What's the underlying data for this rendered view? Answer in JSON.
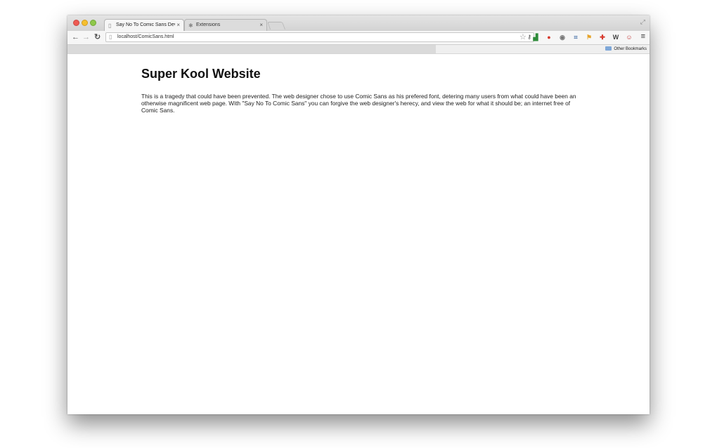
{
  "browser": {
    "tabs": [
      {
        "title": "Say No To Comic Sans Dev",
        "active": true
      },
      {
        "title": "Extensions",
        "active": false
      }
    ],
    "close_glyph": "×",
    "address": "localhost/ComicSans.html",
    "bookmarks_bar": {
      "other_bookmarks": "Other Bookmarks"
    },
    "extension_icons": [
      {
        "name": "bar-chart-extension-icon",
        "glyph": "▟",
        "color": "#2e8b3a"
      },
      {
        "name": "red-circle-extension-icon",
        "glyph": "●",
        "color": "#d6392c"
      },
      {
        "name": "gray-circle-extension-icon",
        "glyph": "◉",
        "color": "#777777"
      },
      {
        "name": "frame-extension-icon",
        "glyph": "⌗",
        "color": "#5a7fb0"
      },
      {
        "name": "bookmark-flag-extension-icon",
        "glyph": "⚑",
        "color": "#e6a329"
      },
      {
        "name": "puzzle-extension-icon",
        "glyph": "✚",
        "color": "#d6392c"
      },
      {
        "name": "wikipedia-extension-icon",
        "glyph": "W",
        "color": "#444444"
      },
      {
        "name": "face-extension-icon",
        "glyph": "☺",
        "color": "#c23a3a"
      }
    ]
  },
  "page": {
    "heading": "Super Kool Website",
    "paragraph": "This is a tragedy that could have been prevented. The web designer chose to use Comic Sans as his prefered font, detering many users from what could have been an otherwise magnificent web page. With \"Say No To Comic Sans\" you can forgive the web designer's herecy, and view the web for what it should be; an internet free of Comic Sans."
  }
}
